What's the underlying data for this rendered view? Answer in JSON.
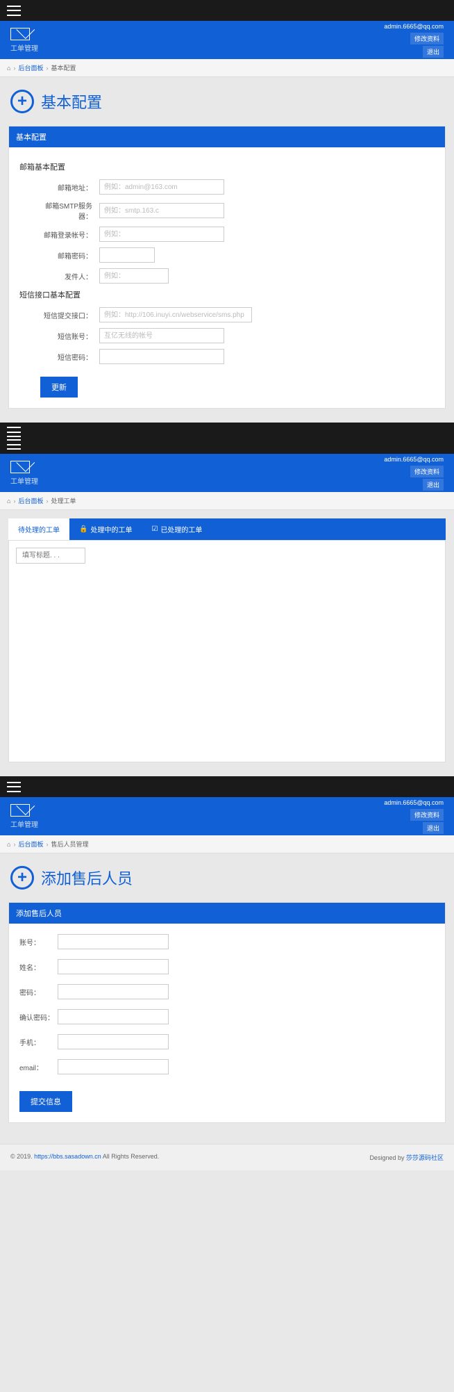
{
  "app_title": "工单管理",
  "user": {
    "email": "admin.6665@qq.com",
    "edit_profile": "修改资料",
    "logout": "退出"
  },
  "section1": {
    "breadcrumb": {
      "home": "后台面板",
      "current": "基本配置"
    },
    "page_title": "基本配置",
    "panel_title": "基本配置",
    "group1_title": "邮箱基本配置",
    "email_addr": {
      "label": "邮箱地址：",
      "placeholder": "例如：admin@163.com"
    },
    "smtp": {
      "label": "邮箱SMTP服务器：",
      "placeholder": "例如：smtp.163.c"
    },
    "login": {
      "label": "邮箱登录帐号：",
      "placeholder": "例如："
    },
    "pwd": {
      "label": "邮箱密码："
    },
    "sender": {
      "label": "发件人：",
      "placeholder": "例如："
    },
    "group2_title": "短信接口基本配置",
    "sms_url": {
      "label": "短信提交接口：",
      "placeholder": "例如：http://106.inuyi.cn/webservice/sms.php"
    },
    "sms_acct": {
      "label": "短信账号：",
      "placeholder": "互亿无线的帐号"
    },
    "sms_pwd": {
      "label": "短信密码："
    },
    "submit": "更新"
  },
  "section2": {
    "breadcrumb": {
      "home": "后台面板",
      "current": "处理工单"
    },
    "tabs": {
      "pending": "待处理的工单",
      "processing": "处理中的工单",
      "done": "已处理的工单"
    },
    "filter_placeholder": "填写标题. . ."
  },
  "section3": {
    "breadcrumb": {
      "home": "后台面板",
      "current": "售后人员管理"
    },
    "page_title": "添加售后人员",
    "panel_title": "添加售后人员",
    "fields": {
      "account": "账号：",
      "name": "姓名：",
      "password": "密码：",
      "confirm": "确认密码：",
      "phone": "手机：",
      "email": "email："
    },
    "submit": "提交信息"
  },
  "footer": {
    "copyright_prefix": "© 2019. ",
    "copyright_url": "https://bbs.sasadown.cn",
    "copyright_suffix": " All Rights Reserved.",
    "designed_prefix": "Designed by ",
    "designed_by": "莎莎源码社区"
  }
}
